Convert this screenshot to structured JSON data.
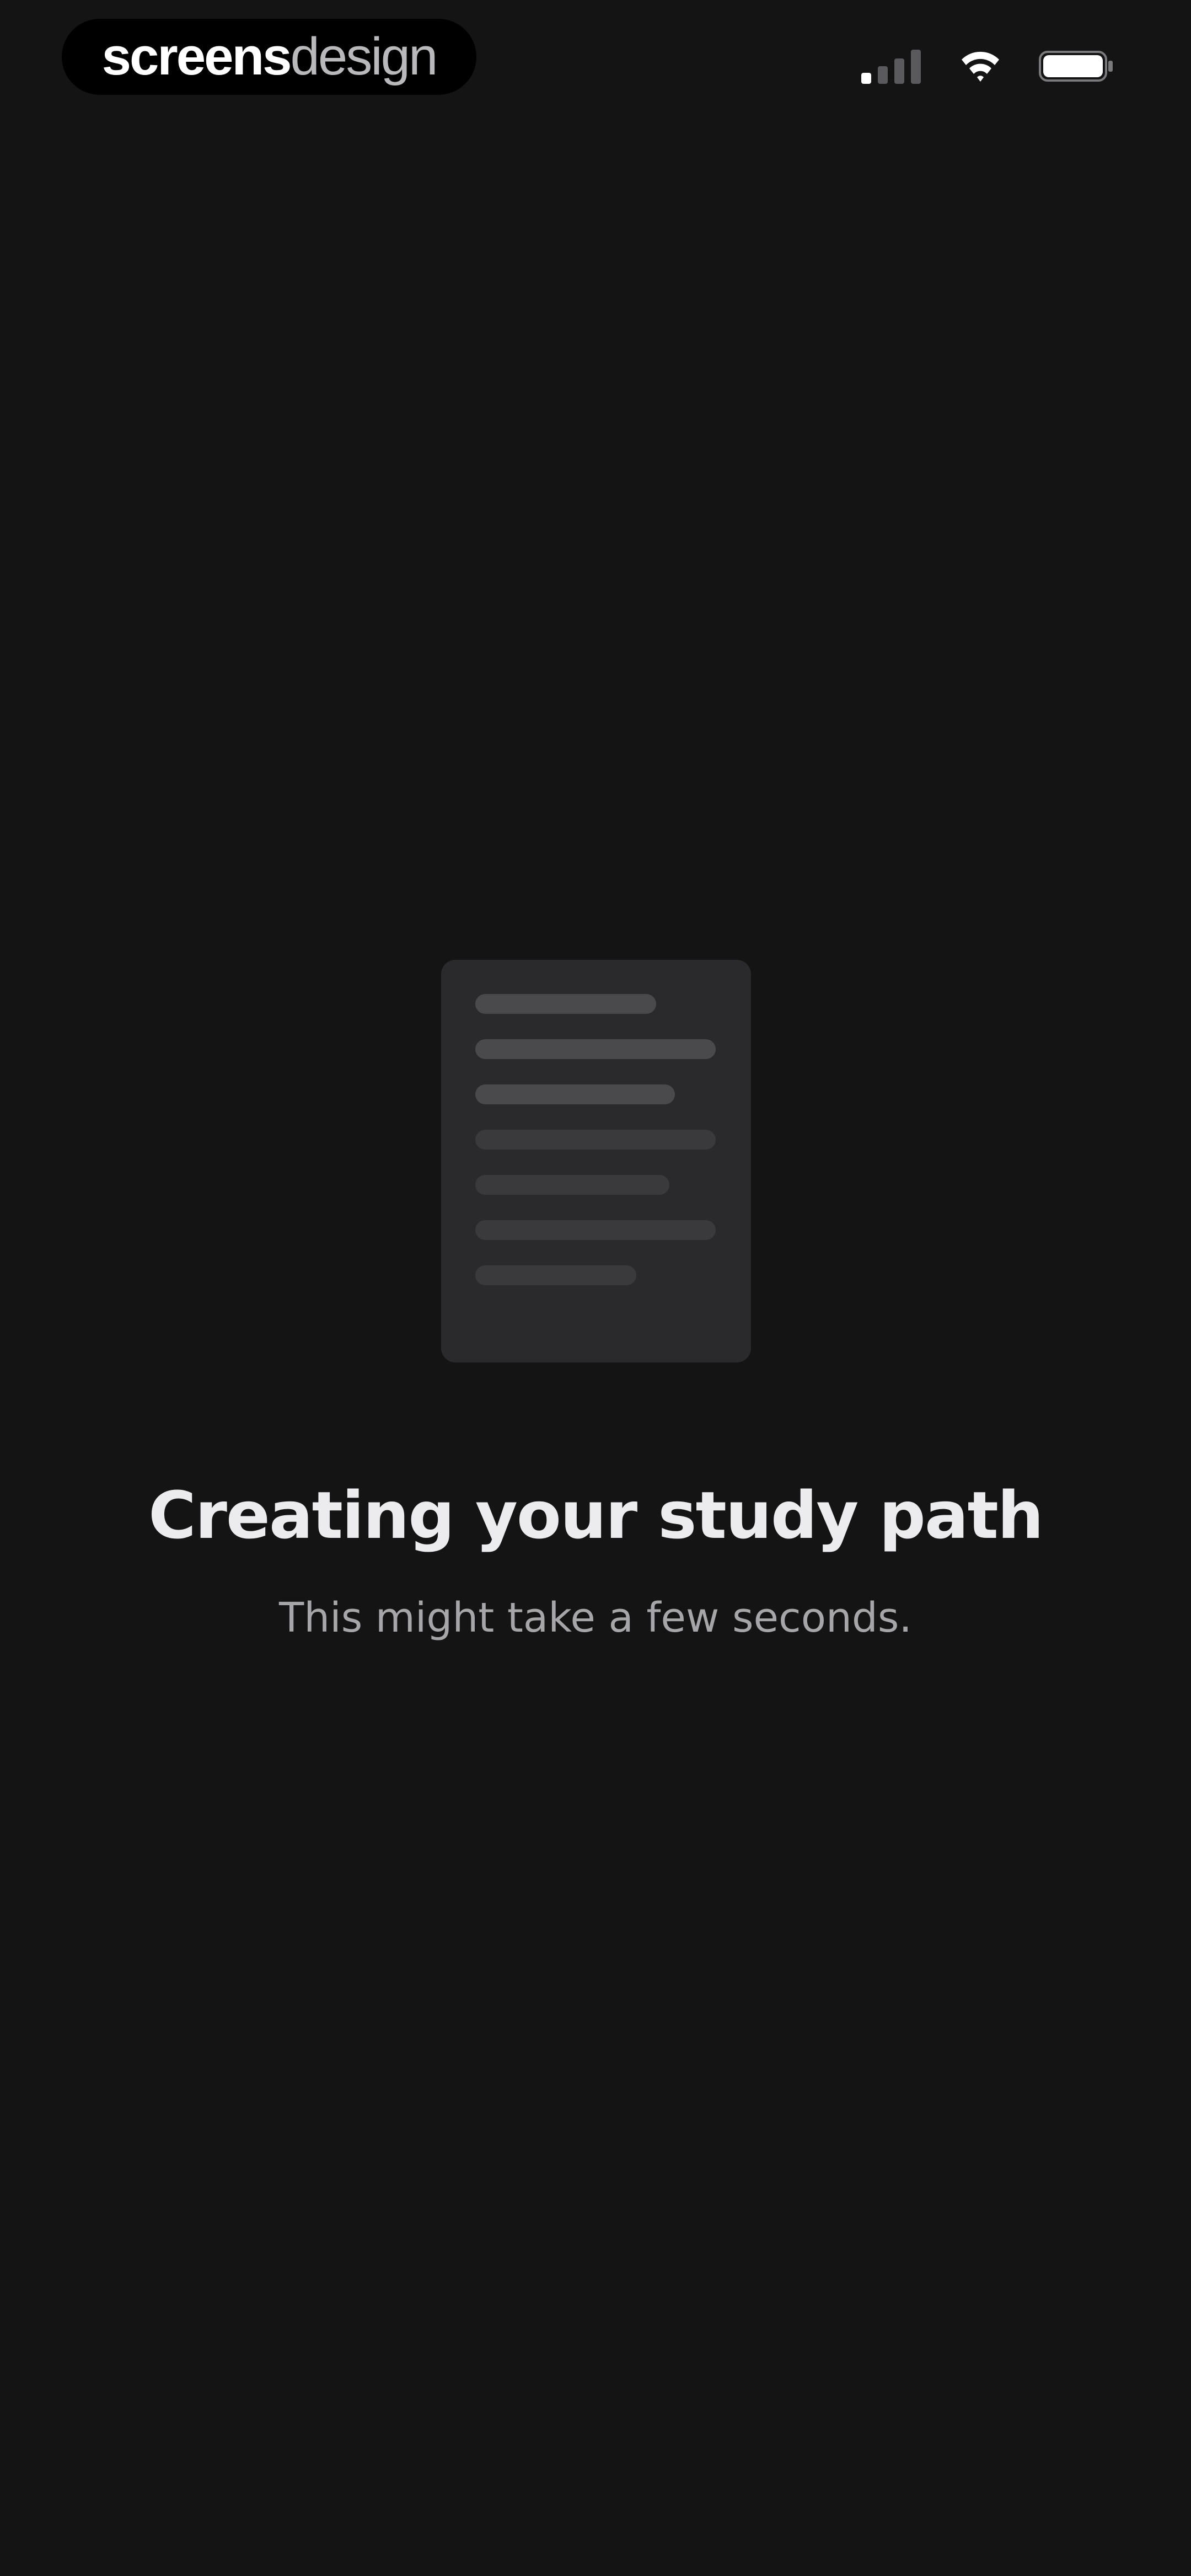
{
  "status_bar": {
    "brand_bold": "screens",
    "brand_light": "design",
    "icons": [
      "signal-icon",
      "wifi-icon",
      "battery-icon"
    ]
  },
  "main": {
    "illustration_icon": "document-icon",
    "title": "Creating your study path",
    "subtitle": "This might take a few seconds."
  },
  "colors": {
    "background": "#141415",
    "card": "#2a2a2c",
    "text_primary": "#ececee",
    "text_secondary": "#a6a6a8"
  }
}
